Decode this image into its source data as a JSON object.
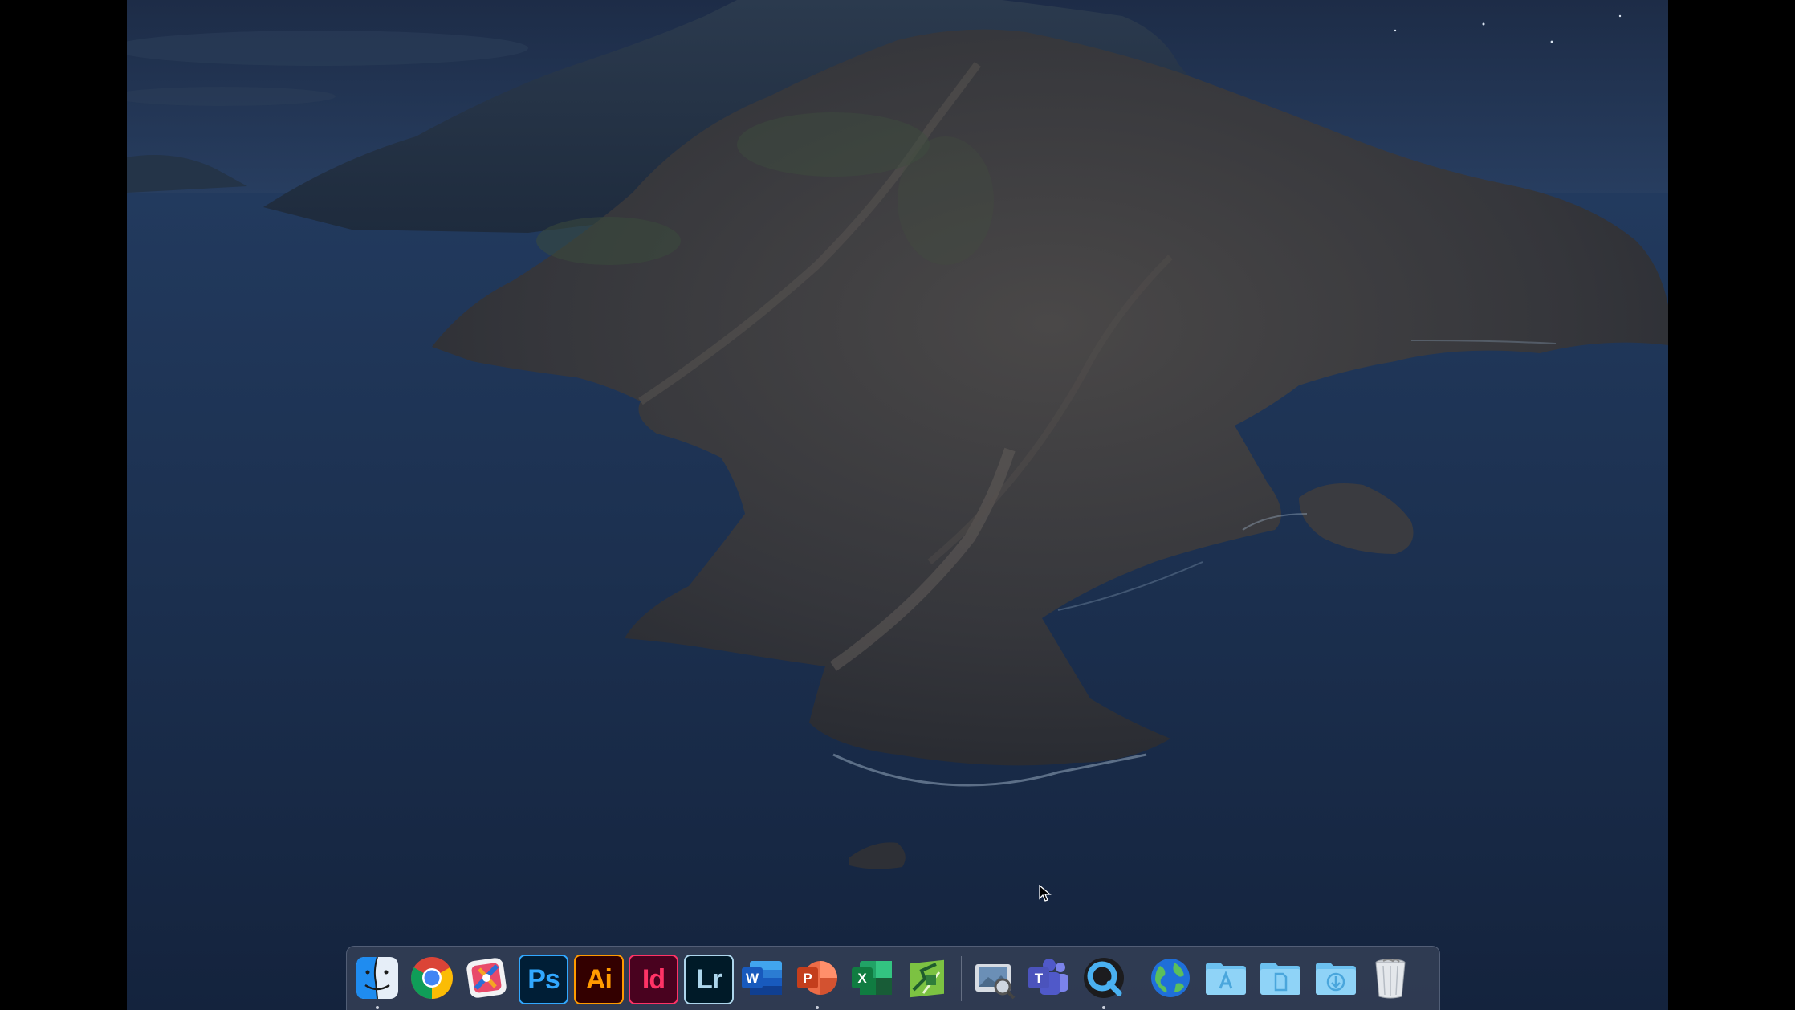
{
  "desktop": {
    "wallpaper": "island-coast-dusk",
    "colors": {
      "sky": "#223659",
      "ocean": "#1a2c47",
      "rock": "#3a3a3f"
    }
  },
  "dock": {
    "apps": [
      {
        "name": "Finder",
        "icon": "finder-icon",
        "running": true
      },
      {
        "name": "Google Chrome",
        "icon": "chrome-icon",
        "running": false
      },
      {
        "name": "Xcode Instruments",
        "icon": "tools-app-icon",
        "running": false
      },
      {
        "name": "Photoshop",
        "icon": "photoshop-icon",
        "label": "Ps",
        "color": "#31a8ff",
        "bg": "#001e36",
        "running": false
      },
      {
        "name": "Illustrator",
        "icon": "illustrator-icon",
        "label": "Ai",
        "color": "#ff9a00",
        "bg": "#330000",
        "running": false
      },
      {
        "name": "InDesign",
        "icon": "indesign-icon",
        "label": "Id",
        "color": "#ff3366",
        "bg": "#49021f",
        "running": false
      },
      {
        "name": "Lightroom Classic",
        "icon": "lightroom-icon",
        "label": "Lr",
        "color": "#add5ec",
        "bg": "#001a28",
        "running": false
      },
      {
        "name": "Microsoft Word",
        "icon": "word-icon",
        "label": "W",
        "running": false
      },
      {
        "name": "Microsoft PowerPoint",
        "icon": "powerpoint-icon",
        "label": "P",
        "running": true
      },
      {
        "name": "Microsoft Excel",
        "icon": "excel-icon",
        "label": "X",
        "running": false
      },
      {
        "name": "Maps App",
        "icon": "map-app-icon",
        "running": false
      },
      {
        "name": "Preview",
        "icon": "preview-icon",
        "running": false
      },
      {
        "name": "Microsoft Teams",
        "icon": "teams-icon",
        "label": "T",
        "running": false
      },
      {
        "name": "QuickTime Player",
        "icon": "quicktime-icon",
        "running": true
      }
    ],
    "stacks": [
      {
        "name": "Browser",
        "icon": "globe-icon"
      },
      {
        "name": "Applications",
        "icon": "applications-folder-icon"
      },
      {
        "name": "Documents",
        "icon": "documents-folder-icon"
      },
      {
        "name": "Downloads",
        "icon": "downloads-folder-icon"
      },
      {
        "name": "Trash",
        "icon": "trash-icon"
      }
    ]
  }
}
